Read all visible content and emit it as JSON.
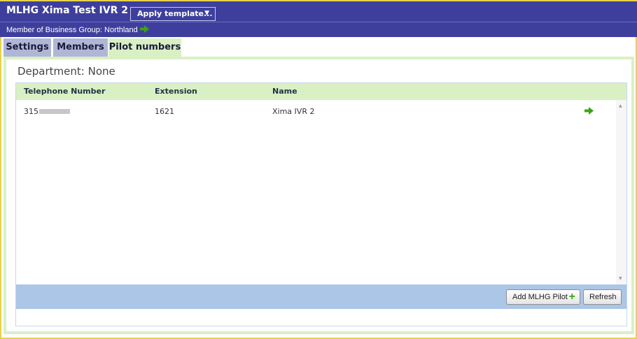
{
  "header": {
    "title": "MLHG Xima Test IVR 2",
    "apply_template_label": "Apply template..."
  },
  "subheader": {
    "text": "Member of Business Group: Northland"
  },
  "tabs": [
    {
      "label": "Settings",
      "active": false
    },
    {
      "label": "Members",
      "active": false
    },
    {
      "label": "Pilot numbers",
      "active": true
    }
  ],
  "department": {
    "label": "Department:",
    "value": "None"
  },
  "grid": {
    "columns": [
      "Telephone Number",
      "Extension",
      "Name"
    ],
    "rows": [
      {
        "telephone_prefix": "315",
        "extension": "1621",
        "name": "Xima IVR 2"
      }
    ]
  },
  "footer": {
    "add_label": "Add MLHG Pilot",
    "refresh_label": "Refresh"
  },
  "colors": {
    "header_bg": "#3e3f9d",
    "accent_green": "#d9f0c4",
    "tab_inactive": "#b0b6d6",
    "footer_blue": "#abc6e6",
    "border_yellow": "#e6d24a",
    "arrow_green": "#3aa414"
  }
}
